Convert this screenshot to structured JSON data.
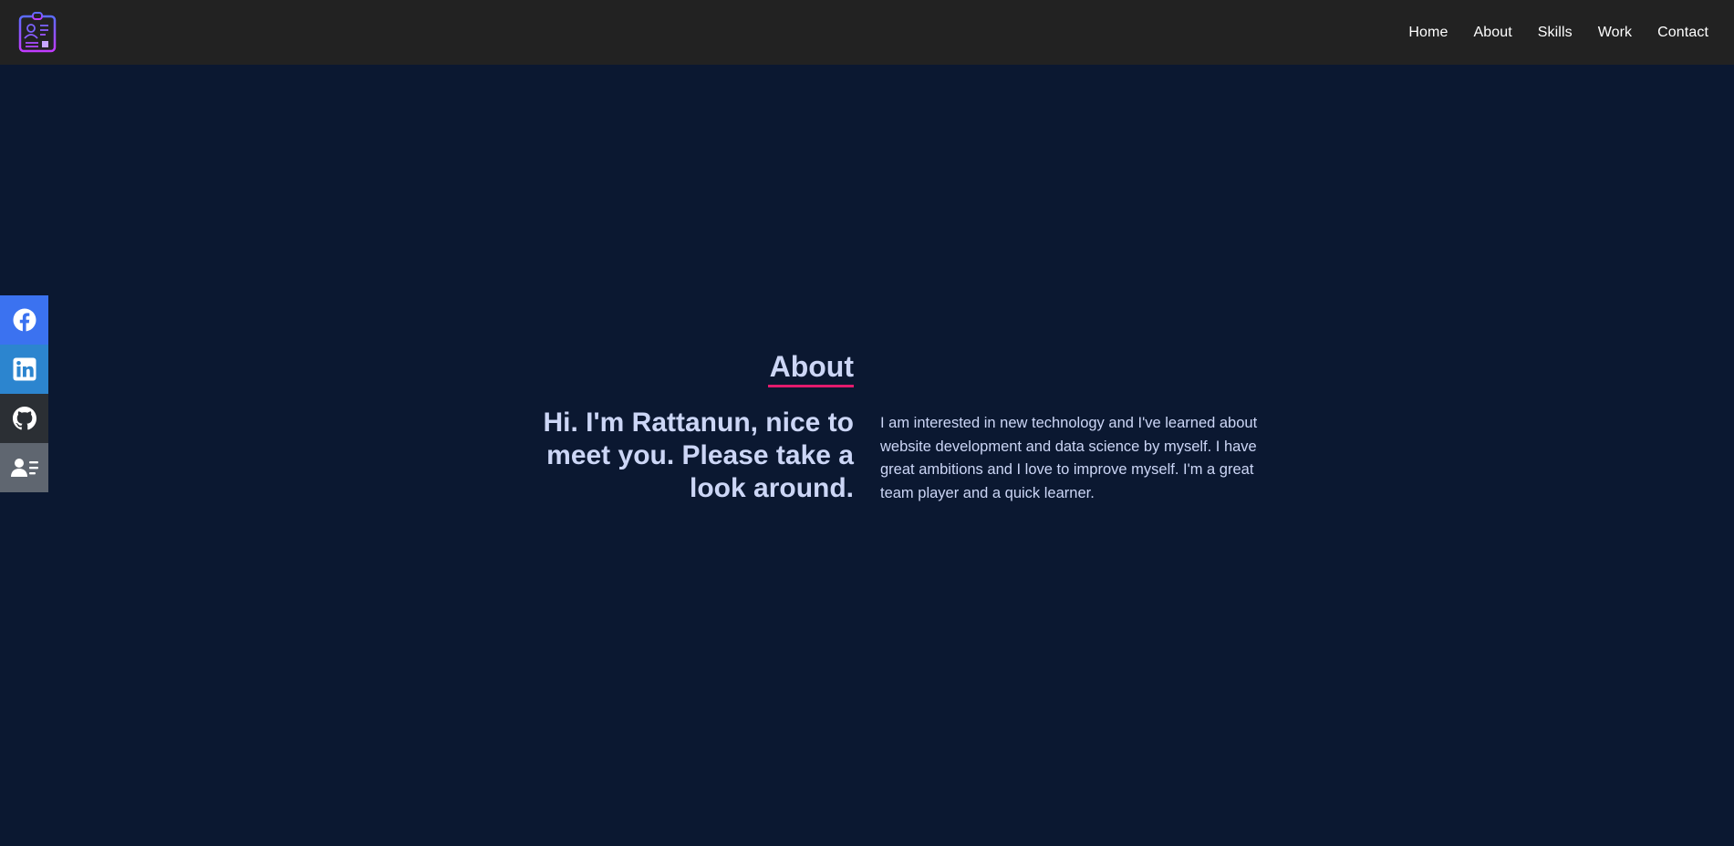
{
  "navbar": {
    "logo_icon": "id-badge-icon",
    "links": [
      {
        "label": "Home"
      },
      {
        "label": "About"
      },
      {
        "label": "Skills"
      },
      {
        "label": "Work"
      },
      {
        "label": "Contact"
      }
    ]
  },
  "social": [
    {
      "icon": "facebook-icon",
      "color": "#3b72f0"
    },
    {
      "icon": "linkedin-icon",
      "color": "#2c85cf"
    },
    {
      "icon": "github-icon",
      "color": "#2b2f34"
    },
    {
      "icon": "contact-card-icon",
      "color": "#5f6670"
    }
  ],
  "about": {
    "title": "About",
    "headline": "Hi. I'm Rattanun, nice to meet you. Please take a look around.",
    "bio": "I am interested in new technology and I've learned about website development and data science by myself. I have great ambitions and I love to improve myself. I'm a great team player and a quick learner."
  },
  "colors": {
    "background": "#0b1831",
    "navbar": "#222222",
    "accent": "#e31b6d",
    "text": "#ccd6f6"
  }
}
